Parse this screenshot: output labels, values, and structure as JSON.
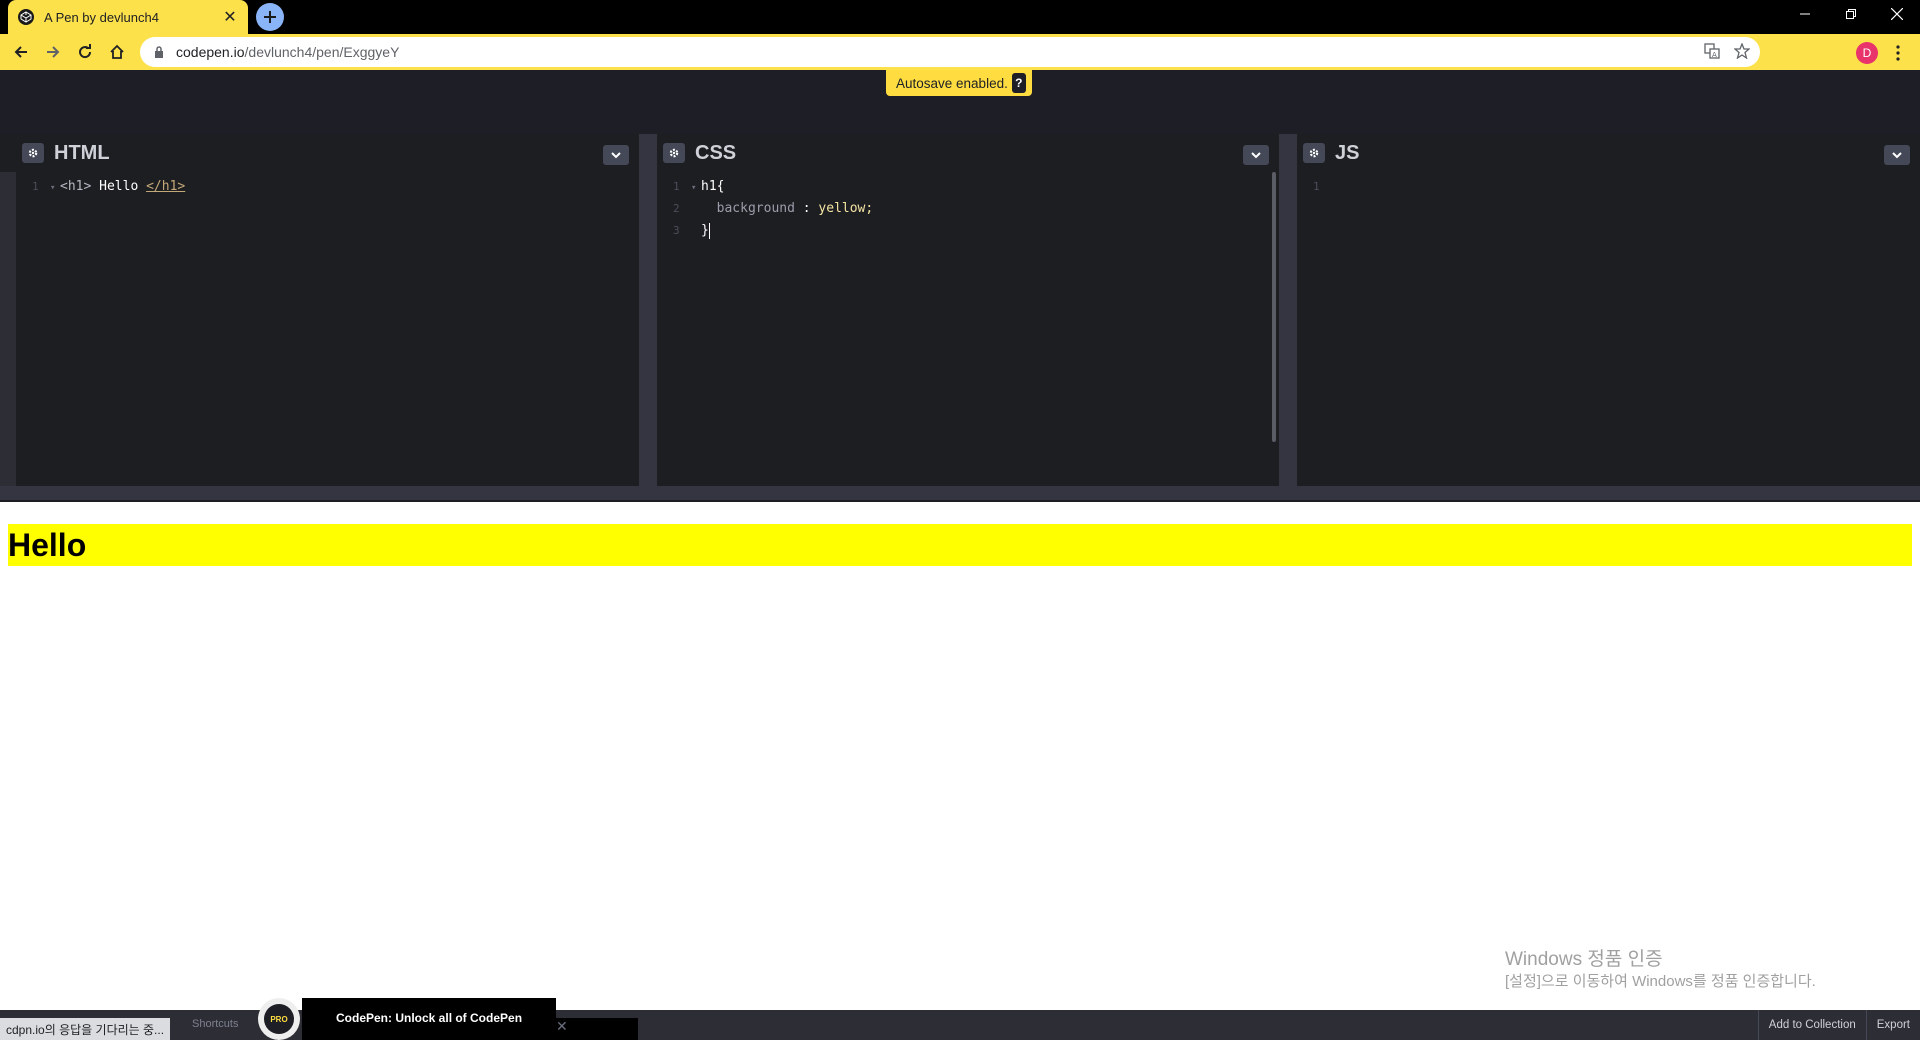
{
  "browser": {
    "tab_title": "A Pen by devlunch4",
    "url_host": "codepen.io",
    "url_path": "/devlunch4/pen/ExggyeY",
    "avatar_letter": "D"
  },
  "codepen": {
    "autosave_text": "Autosave enabled.",
    "autosave_help": "?",
    "editors": {
      "html": {
        "title": "HTML",
        "lines": [
          {
            "num": "1",
            "open": "<h1>",
            "text": " Hello ",
            "close": "</h1>"
          }
        ]
      },
      "css": {
        "title": "CSS",
        "lines": [
          {
            "num": "1",
            "selector": "h1{"
          },
          {
            "num": "2",
            "prop": "background",
            "sep": " : ",
            "value": "yellow;"
          },
          {
            "num": "3",
            "brace": "}"
          }
        ]
      },
      "js": {
        "title": "JS",
        "lines": [
          {
            "num": "1"
          }
        ]
      }
    },
    "preview": {
      "heading": "Hello",
      "heading_bg": "#ffff00"
    },
    "footer": {
      "status_text": "cdpn.io의 응답을 기다리는 중...",
      "shortcuts": "Shortcuts",
      "promo_badge": "PRO",
      "promo_title": "CodePen: Unlock all of CodePen",
      "add_to_collection": "Add to Collection",
      "export": "Export"
    }
  },
  "watermark": {
    "line1": "Windows 정품 인증",
    "line2": "[설정]으로 이동하여 Windows를 정품 인증합니다."
  },
  "colors": {
    "chrome_accent": "#fde14a",
    "editor_bg": "#1d1e22",
    "header_bg": "#1e1f26",
    "autosave_bg": "#ffdd40"
  },
  "icons": {
    "tab": "codepen-icon",
    "close": "close-icon",
    "new_tab": "plus-icon",
    "back": "back-arrow-icon",
    "forward": "forward-arrow-icon",
    "reload": "reload-icon",
    "home": "home-icon",
    "lock": "lock-icon",
    "translate": "translate-icon",
    "bookmark": "star-icon",
    "menu": "more-vertical-icon",
    "settings": "gear-icon",
    "collapse": "chevron-down-icon"
  }
}
